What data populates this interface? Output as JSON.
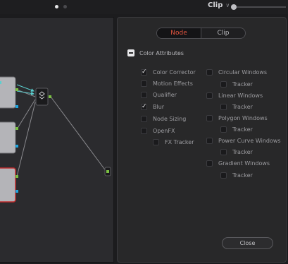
{
  "header": {
    "clip_dropdown": {
      "label": "Clip",
      "chevron_icon": "chevron-down-icon"
    },
    "page_dots": {
      "count": 2,
      "active_index": 0
    },
    "zoom_slider": {
      "value": 0
    }
  },
  "node_graph": {
    "colors": {
      "node_body": "#b4b4b8",
      "node_selected_border": "#c02a2a",
      "input_green": "#7ac043",
      "input_cyan": "#1ea7e1",
      "key_arrows": "#5ad0d0",
      "link_line": "#8a8a8e"
    },
    "nodes": [
      {
        "id": "node-1",
        "selected": false
      },
      {
        "id": "node-2",
        "selected": false
      },
      {
        "id": "node-3",
        "selected": true
      }
    ],
    "mixer_icon": "layer-mixer-icon"
  },
  "panel": {
    "tabs": [
      {
        "label": "Node",
        "active": true
      },
      {
        "label": "Clip",
        "active": false
      }
    ],
    "section": {
      "title": "Color Attributes",
      "icon": "collapse-minus-icon"
    },
    "left_options": [
      {
        "label": "Color Corrector",
        "checked": true
      },
      {
        "label": "Motion Effects",
        "checked": false
      },
      {
        "label": "Qualifier",
        "checked": false
      },
      {
        "label": "Blur",
        "checked": true
      },
      {
        "label": "Node Sizing",
        "checked": false
      },
      {
        "label": "OpenFX",
        "checked": false
      },
      {
        "label": "FX Tracker",
        "checked": false
      }
    ],
    "right_options": [
      {
        "label": "Circular Windows",
        "checked": false
      },
      {
        "label": "Tracker",
        "checked": false
      },
      {
        "label": "Linear Windows",
        "checked": false
      },
      {
        "label": "Tracker",
        "checked": false
      },
      {
        "label": "Polygon Windows",
        "checked": false
      },
      {
        "label": "Tracker",
        "checked": false
      },
      {
        "label": "Power Curve Windows",
        "checked": false
      },
      {
        "label": "Tracker",
        "checked": false
      },
      {
        "label": "Gradient Windows",
        "checked": false
      },
      {
        "label": "Tracker",
        "checked": false
      }
    ],
    "close_label": "Close",
    "check_glyph": "✓"
  }
}
